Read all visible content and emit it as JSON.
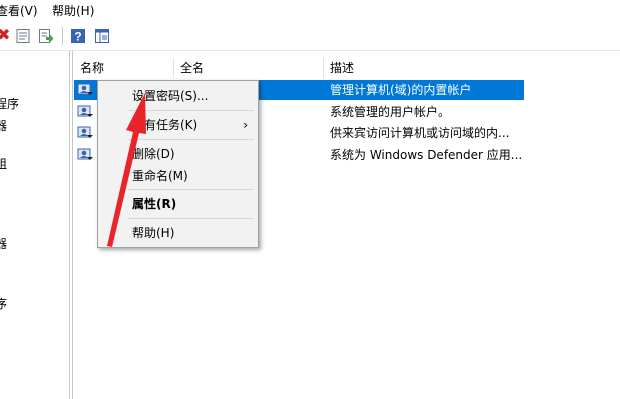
{
  "menubar": {
    "view": "查看(V)",
    "help": "帮助(H)"
  },
  "toolbar": {
    "icons": [
      "delete-icon",
      "properties-icon",
      "export-icon",
      "help-icon",
      "show-hide-pane-icon"
    ],
    "delete_glyph": "✖",
    "help_glyph": "?"
  },
  "left_pane": {
    "fragments": [
      "程序",
      "器",
      "组",
      "器",
      "序"
    ]
  },
  "columns": {
    "name": "名称",
    "fullname": "全名",
    "description": "描述"
  },
  "users": [
    {
      "description": "管理计算机(域)的内置帐户",
      "selected": true
    },
    {
      "description": "系统管理的用户帐户。",
      "selected": false
    },
    {
      "description": "供来宾访问计算机或访问域的内...",
      "selected": false
    },
    {
      "description": "系统为 Windows Defender 应用...",
      "selected": false
    }
  ],
  "context_menu": {
    "set_password": "设置密码(S)...",
    "all_tasks": "所有任务(K)",
    "submenu_arrow": "›",
    "delete": "删除(D)",
    "rename": "重命名(M)",
    "properties": "属性(R)",
    "help": "帮助(H)"
  },
  "colors": {
    "selection": "#0078d7",
    "annotation_arrow": "#e8232a"
  }
}
